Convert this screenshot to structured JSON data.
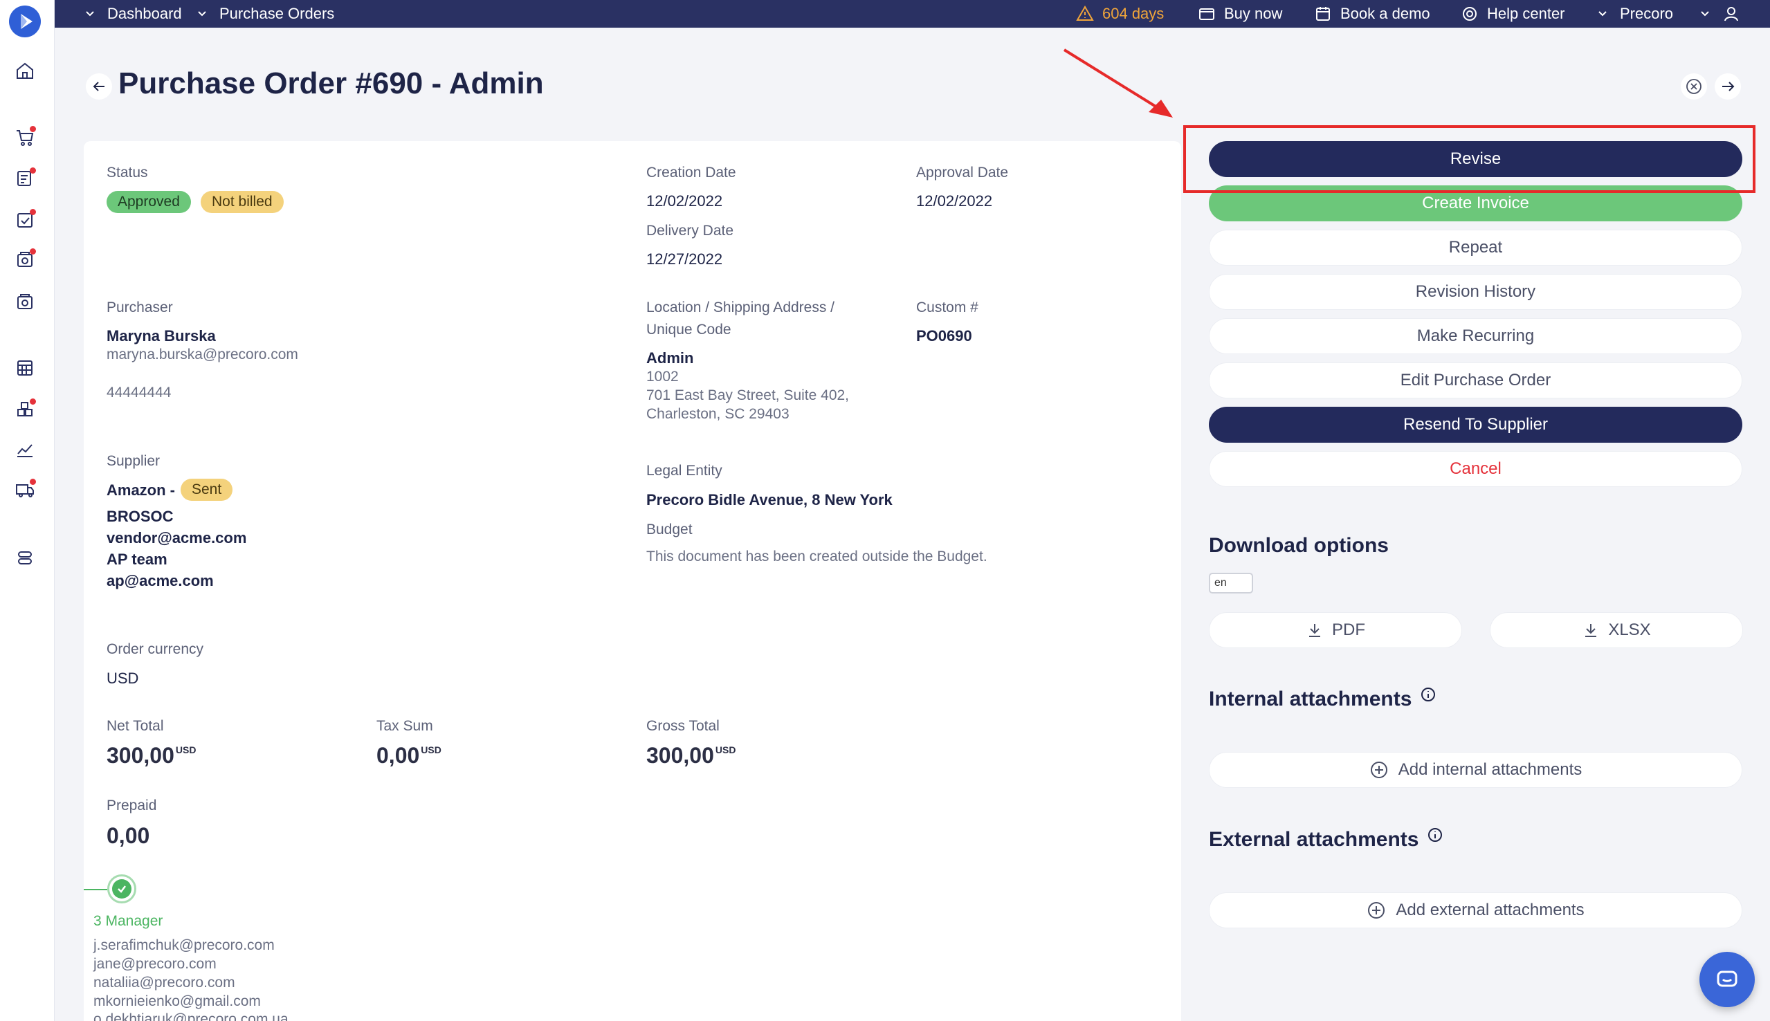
{
  "topbar": {
    "breadcrumb": [
      "Dashboard",
      "Purchase Orders"
    ],
    "trial_days": "604 days",
    "buy_now": "Buy now",
    "book_demo": "Book a demo",
    "help_center": "Help center",
    "account": "Precoro"
  },
  "page": {
    "title": "Purchase Order #690 - Admin"
  },
  "order": {
    "status_label": "Status",
    "status_badges": [
      "Approved",
      "Not billed"
    ],
    "creation_date_label": "Creation Date",
    "creation_date": "12/02/2022",
    "approval_date_label": "Approval Date",
    "approval_date": "12/02/2022",
    "delivery_date_label": "Delivery Date",
    "delivery_date": "12/27/2022",
    "purchaser_label": "Purchaser",
    "purchaser_name": "Maryna Burska",
    "purchaser_email": "maryna.burska@precoro.com",
    "purchaser_phone": "44444444",
    "location_label_1": "Location / Shipping Address /",
    "location_label_2": "Unique Code",
    "location_name": "Admin",
    "location_code": "1002",
    "location_address_1": "701 East Bay Street, Suite 402,",
    "location_address_2": "Charleston, SC 29403",
    "custom_label": "Custom #",
    "custom_value": "PO0690",
    "supplier_label": "Supplier",
    "supplier_name": "Amazon -",
    "supplier_badge": "Sent",
    "supplier_code": "BROSOC",
    "supplier_email": "vendor@acme.com",
    "supplier_team": "AP team",
    "supplier_team_email": "ap@acme.com",
    "legal_entity_label": "Legal Entity",
    "legal_entity": "Precoro Bidle Avenue, 8 New York",
    "budget_label": "Budget",
    "budget_text": "This document has been created outside the Budget.",
    "currency_label": "Order currency",
    "currency": "USD",
    "net_total_label": "Net Total",
    "net_total": "300,00",
    "tax_sum_label": "Tax Sum",
    "tax_sum": "0,00",
    "gross_total_label": "Gross Total",
    "gross_total": "300,00",
    "currency_unit": "USD",
    "prepaid_label": "Prepaid",
    "prepaid": "0,00"
  },
  "approval": {
    "step_label": "3 Manager",
    "emails": [
      "j.serafimchuk@precoro.com",
      "jane@precoro.com",
      "nataliia@precoro.com",
      "mkornieienko@gmail.com",
      "o.dekhtiaruk@precoro.com.ua"
    ]
  },
  "actions": {
    "revise": "Revise",
    "create_invoice": "Create Invoice",
    "repeat": "Repeat",
    "revision_history": "Revision History",
    "make_recurring": "Make Recurring",
    "edit_po": "Edit Purchase Order",
    "resend": "Resend To Supplier",
    "cancel": "Cancel"
  },
  "downloads": {
    "title": "Download options",
    "language": "en",
    "pdf": "PDF",
    "xlsx": "XLSX"
  },
  "attachments": {
    "internal_title": "Internal attachments",
    "internal_add": "Add internal attachments",
    "external_title": "External attachments",
    "external_add": "Add external attachments"
  },
  "colors": {
    "primary_dark": "#232a5c",
    "green": "#6cc77a",
    "danger": "#e5323b",
    "warning": "#f0a53a",
    "highlight": "#e62a2a"
  }
}
